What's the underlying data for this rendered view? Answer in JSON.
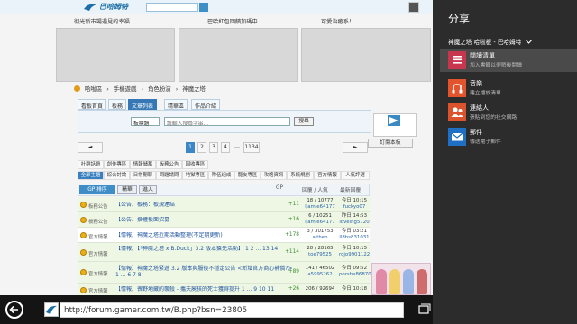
{
  "colors": {
    "charm_bg": "#2c2c2c",
    "selected_item": "#4a4a4a",
    "reading_list": "#c7354e",
    "music": "#e4542c",
    "people": "#da532c",
    "mail": "#1f6fc4",
    "link_blue": "#2457a0",
    "tab_active": "#3578b5"
  },
  "browser": {
    "url": "http://forum.gamer.com.tw/B.php?bsn=23805",
    "back_icon": "arrow-left-icon",
    "tabs_icon": "tabs-icon"
  },
  "page": {
    "logo": "巴哈姆特",
    "promo": [
      "彻光新市場遇見的幸福",
      "巴哈紅包回饋加碼中",
      "可愛治癒系！"
    ],
    "breadcrumb": [
      "哈啦區",
      "手機遊戲",
      "角色扮演",
      "神魔之塔"
    ],
    "tabs": [
      "看板首頁",
      "板務",
      "文章列表",
      "精華區",
      "作品介紹"
    ],
    "filter": {
      "select": "板標題",
      "placeholder": "請輸入搜尋字串...",
      "button": "搜尋"
    },
    "subscribe": "訂閱本板",
    "pager": {
      "prev": "◄",
      "pages": [
        "1",
        "2",
        "3",
        "4"
      ],
      "ellipsis": "...",
      "last": "1134",
      "next": "►"
    },
    "categories_row1": [
      "社群話題",
      "創作專區",
      "情報儲蓄",
      "板務公告",
      "回收專區"
    ],
    "categories_row2": [
      "全部主題",
      "綜合討論",
      "日常閒聊",
      "問題請問",
      "地獄專區",
      "隊伍組成",
      "龍友專區",
      "攻略資訊",
      "系統規劃",
      "官方情報",
      "人氣評選"
    ],
    "table_header": {
      "sort": "GP 排序",
      "mod": "精華",
      "enter": "進入",
      "gp": "GP",
      "replies": "回覆 / 人氣",
      "last": "最新回覆"
    },
    "rows": [
      {
        "tag": "板務公告",
        "title": "【公告】板務：板規連結",
        "gp": "+11",
        "counts": "18 / 10777",
        "author": "ljamie64177",
        "time": "今日 10:15",
        "last_user": "fuckyo07"
      },
      {
        "tag": "板務公告",
        "title": "【公告】撰權板面招募",
        "gp": "+16",
        "counts": "6 / 10251",
        "author": "ljamie64177",
        "time": "昨日 14:53",
        "last_user": "loveing5720"
      },
      {
        "tag": "官方情報",
        "title": "【情報】神魔之塔近期活動整理(不定期更新)",
        "gp": "+178",
        "counts": "3 / 301753",
        "author": "aithen",
        "time": "今日 03:21",
        "last_user": "ll8bs831031"
      },
      {
        "tag": "官方情報",
        "title": "【情報】【「神魔之塔 x B.Duck」3.2 版本搶先活動】",
        "pages": "1  2  ...  13  14",
        "gp": "+114",
        "counts": "28 / 28165",
        "author": "toe79525",
        "time": "今日 10:15",
        "last_user": "rojo9901122"
      },
      {
        "tag": "官方情報",
        "title": "【情報】神魔之塔緊遊 3.2 版本與服後不穩定公告 <新增官方商心補償?>",
        "pages": "1  ...  6  7  8",
        "gp": "+89",
        "counts": "141 / 46502",
        "author": "a5995262",
        "time": "今日 09:52",
        "last_user": "porshe868703"
      },
      {
        "tag": "官方情報",
        "title": "【情報】喪野地藏的襲殺 - 攜天屍核的死士獲得提升",
        "pages": "1  ...  9  10  11",
        "gp": "+26",
        "counts": "206 / 92694",
        "author": "",
        "time": "今日 10:18",
        "last_user": ""
      }
    ]
  },
  "share": {
    "title": "分享",
    "source": "神魔之塔 哈啦板 - 巴哈姆特",
    "source_chevron": "chevron-down-icon",
    "targets": [
      {
        "name": "閱讀清單",
        "desc": "加入書籤以便稍後閱讀",
        "icon": "reading-list-icon",
        "selected": true
      },
      {
        "name": "音樂",
        "desc": "建立播放清單",
        "icon": "music-icon",
        "selected": false
      },
      {
        "name": "連絡人",
        "desc": "張貼到您的社交網路",
        "icon": "people-icon",
        "selected": false
      },
      {
        "name": "郵件",
        "desc": "傳送電子郵件",
        "icon": "mail-icon",
        "selected": false
      }
    ]
  }
}
